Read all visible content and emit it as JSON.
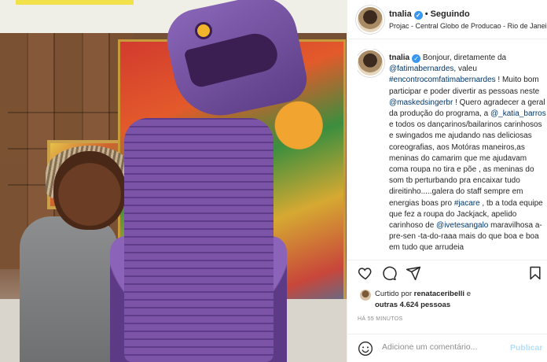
{
  "header": {
    "username": "tnalia",
    "separator": "•",
    "follow_label": "Seguindo",
    "location": "Projac - Central Globo de Producao - Rio de Janeiro"
  },
  "caption": {
    "username": "tnalia",
    "segments": [
      {
        "t": "Bonjour, diretamente da "
      },
      {
        "t": "@fatimabernardes",
        "link": true
      },
      {
        "t": ", valeu "
      },
      {
        "t": "#encontrocomfatimabernardes",
        "link": true
      },
      {
        "t": " ! Muito bom participar e poder divertir as pessoas neste "
      },
      {
        "t": "@maskedsingerbr",
        "link": true
      },
      {
        "t": " ! Quero agradecer a geral da produção do programa, a "
      },
      {
        "t": "@_katia_barros",
        "link": true
      },
      {
        "t": " e todos os dançarinos/bailarinos carinhosos e swingados me ajudando nas deliciosas coreografias, aos Motóras maneiros,as meninas do camarim que me ajudavam coma roupa no tira e põe , as meninas do som tb perturbando pra encaixar tudo direitinho.....galera do staff sempre em energias boas pro "
      },
      {
        "t": "#jacare",
        "link": true
      },
      {
        "t": " , tb a toda equipe que fez a roupa do Jackjack, apelido carinhoso de "
      },
      {
        "t": "@ivetesangalo",
        "link": true
      },
      {
        "t": " maravilhosa a-pre-sen -ta-do-raaa mais do que boa e boa em tudo que arrudeia"
      }
    ]
  },
  "likes": {
    "prefix": "Curtido por ",
    "user": "renataceribelli",
    "joiner": " e",
    "others": "outras 4.624 pessoas"
  },
  "timestamp": "HÁ 55 MINUTOS",
  "comment_box": {
    "placeholder": "Adicione um comentário...",
    "publish_label": "Publicar"
  },
  "icons": {
    "like": "heart-icon",
    "comment": "comment-bubble-icon",
    "share": "paper-plane-icon",
    "save": "bookmark-icon",
    "emoji": "smiley-icon",
    "verified": "verified-badge-icon"
  },
  "colors": {
    "link": "#00376b",
    "verified": "#3897f0",
    "publish_disabled": "#b2dffc",
    "muted": "#8e8e8e"
  }
}
